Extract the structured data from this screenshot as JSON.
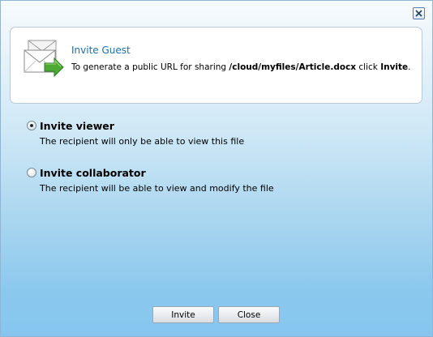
{
  "dialog": {
    "close_icon": "close-x-icon"
  },
  "header": {
    "icon": "envelope-forward-icon",
    "title": "Invite Guest",
    "desc_prefix": "To generate a public URL for sharing ",
    "path": "/cloud/myfiles/Article.docx",
    "desc_middle": " click ",
    "action": "Invite",
    "desc_suffix": "."
  },
  "options": [
    {
      "title": "Invite viewer",
      "description": "The recipient will only be able to view this file",
      "selected": true
    },
    {
      "title": "Invite collaborator",
      "description": "The recipient will be able to view and modify the file",
      "selected": false
    }
  ],
  "buttons": {
    "invite_label": "Invite",
    "close_label": "Close"
  },
  "colors": {
    "title_blue": "#1d6fb0",
    "gradient_bottom": "#86c6ee"
  }
}
